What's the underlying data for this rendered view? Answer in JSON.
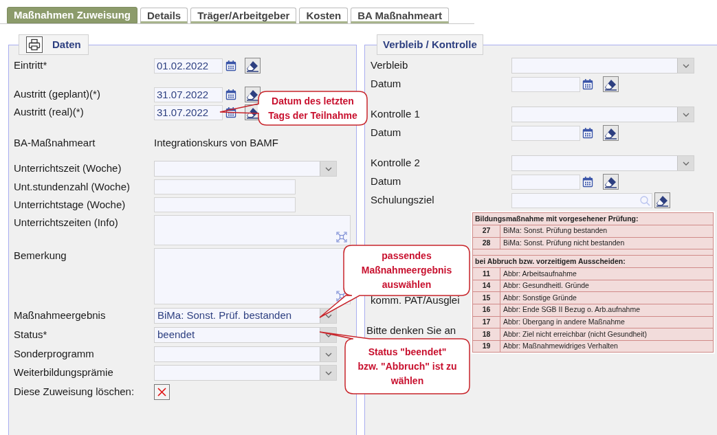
{
  "tabs": [
    {
      "label": "Maßnahmen Zuweisung",
      "selected": true
    },
    {
      "label": "Details",
      "selected": false
    },
    {
      "label": "Träger/Arbeitgeber",
      "selected": false
    },
    {
      "label": "Kosten",
      "selected": false
    },
    {
      "label": "BA Maßnahmeart",
      "selected": false
    }
  ],
  "daten": {
    "title": "Daten",
    "fields": [
      {
        "kind": "date",
        "label": "Eintritt*",
        "value": "01.02.2022"
      },
      {
        "kind": "date",
        "label": "Austritt (geplant)(*)",
        "value": "31.07.2022"
      },
      {
        "kind": "date",
        "label": "Austritt (real)(*)",
        "value": "31.07.2022"
      },
      {
        "kind": "text",
        "label": "BA-Maßnahmeart",
        "value": "Integrationskurs von BAMF"
      },
      {
        "kind": "select",
        "label": "Unterrichtszeit (Woche)"
      },
      {
        "kind": "input",
        "label": "Unt.stundenzahl (Woche)"
      },
      {
        "kind": "input",
        "label": "Unterrichtstage (Woche)"
      },
      {
        "kind": "textarea",
        "label": "Unterrichtszeiten (Info)"
      },
      {
        "kind": "textarea",
        "label": "Bemerkung"
      },
      {
        "kind": "select",
        "label": "Maßnahmeergebnis",
        "value": "BiMa: Sonst. Prüf. bestanden"
      },
      {
        "kind": "select",
        "label": "Status*",
        "value": "beendet"
      },
      {
        "kind": "select",
        "label": "Sonderprogramm"
      },
      {
        "kind": "select",
        "label": "Weiterbildungsprämie"
      },
      {
        "kind": "delete",
        "label": "Diese Zuweisung löschen:"
      }
    ]
  },
  "verbleib": {
    "title": "Verbleib / Kontrolle",
    "fields": [
      {
        "kind": "select",
        "label": "Verbleib"
      },
      {
        "kind": "date",
        "label": "Datum"
      },
      {
        "kind": "select",
        "label": "Kontrolle 1"
      },
      {
        "kind": "date",
        "label": "Datum"
      },
      {
        "kind": "select",
        "label": "Kontrolle 2"
      },
      {
        "kind": "date",
        "label": "Datum"
      },
      {
        "kind": "search",
        "label": "Schulungsziel"
      }
    ],
    "notes": [
      "komm. PAT/Ausglei",
      "Bitte denken Sie an"
    ]
  },
  "legend_table": {
    "sections": [
      {
        "heading": "Bildungsmaßnahme mit vorgesehener Prüfung:",
        "rows": [
          {
            "code": "27",
            "text": "BiMa: Sonst. Prüfung bestanden"
          },
          {
            "code": "28",
            "text": "BiMa: Sonst. Prüfung nicht bestanden"
          }
        ]
      },
      {
        "heading": "bei Abbruch bzw. vorzeitigem Ausscheiden:",
        "rows": [
          {
            "code": "11",
            "text": "Abbr: Arbeitsaufnahme"
          },
          {
            "code": "14",
            "text": "Abbr: Gesundheitl. Gründe"
          },
          {
            "code": "15",
            "text": "Abbr: Sonstige Gründe"
          },
          {
            "code": "16",
            "text": "Abbr: Ende SGB II Bezug o. Arb.aufnahme"
          },
          {
            "code": "17",
            "text": "Abbr: Übergang in andere Maßnahme"
          },
          {
            "code": "18",
            "text": "Abbr: Ziel nicht erreichbar (nicht Gesundheit)"
          },
          {
            "code": "19",
            "text": "Abbr: Maßnahmewidriges Verhalten"
          }
        ]
      }
    ]
  },
  "callouts": [
    {
      "text": "Datum des letzten\nTags der Teilnahme"
    },
    {
      "text": "passendes\nMaßnahmeergebnis\nauswählen"
    },
    {
      "text": "Status \"beendet\"\nbzw. \"Abbruch\" ist zu\nwählen"
    }
  ]
}
